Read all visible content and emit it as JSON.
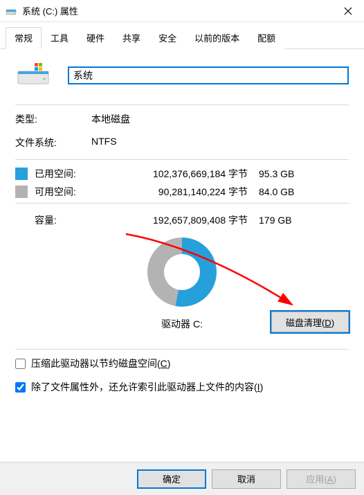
{
  "window": {
    "title": "系统 (C:) 属性"
  },
  "tabs": {
    "general": "常规",
    "tools": "工具",
    "hardware": "硬件",
    "sharing": "共享",
    "security": "安全",
    "previous": "以前的版本",
    "quota": "配额"
  },
  "drive": {
    "name_value": "系统"
  },
  "info": {
    "type_label": "类型:",
    "type_value": "本地磁盘",
    "fs_label": "文件系统:",
    "fs_value": "NTFS"
  },
  "space": {
    "used_label": "已用空间:",
    "used_bytes": "102,376,669,184 字节",
    "used_gb": "95.3 GB",
    "free_label": "可用空间:",
    "free_bytes": "90,281,140,224 字节",
    "free_gb": "84.0 GB",
    "capacity_label": "容量:",
    "capacity_bytes": "192,657,809,408 字节",
    "capacity_gb": "179 GB"
  },
  "chart_data": {
    "type": "pie",
    "title": "驱动器 C:",
    "series": [
      {
        "name": "已用空间",
        "value": 102376669184,
        "color": "#26a0da"
      },
      {
        "name": "可用空间",
        "value": 90281140224,
        "color": "#b3b3b3"
      }
    ]
  },
  "buttons": {
    "cleanup": "磁盘清理(D)",
    "ok": "确定",
    "cancel": "取消",
    "apply": "应用(A)"
  },
  "checkboxes": {
    "compress": "压缩此驱动器以节约磁盘空间(C)",
    "index": "除了文件属性外，还允许索引此驱动器上文件的内容(I)"
  },
  "annotation": {
    "arrow_color": "#ff0000"
  }
}
